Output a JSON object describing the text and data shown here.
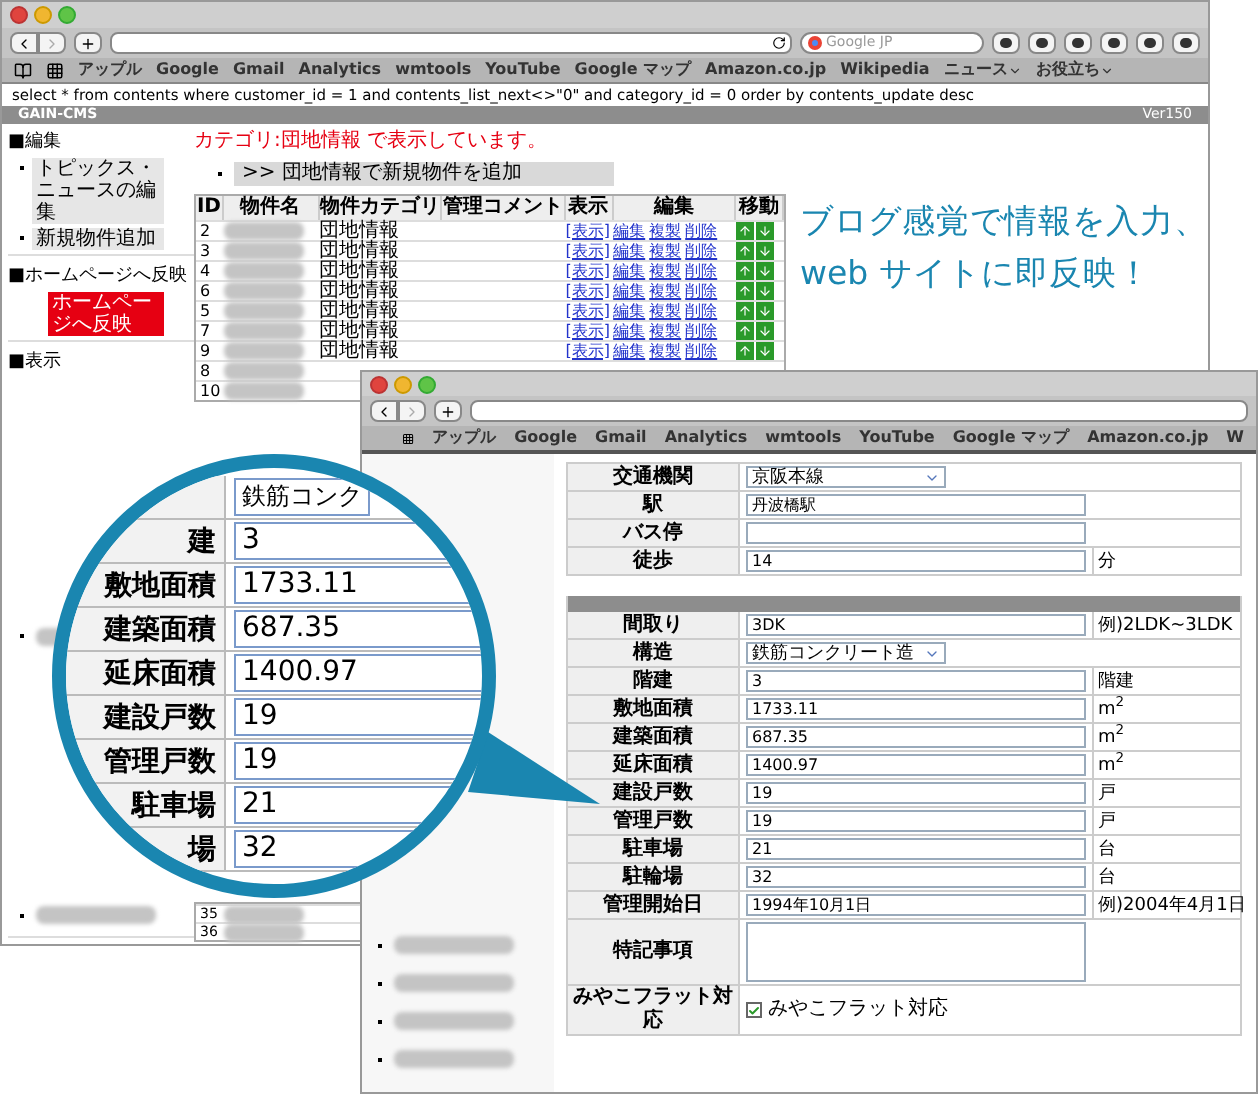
{
  "back_window": {
    "search_placeholder": "Google JP",
    "bookmarks": [
      {
        "label": "アップル",
        "menu": false
      },
      {
        "label": "Google",
        "menu": false
      },
      {
        "label": "Gmail",
        "menu": false
      },
      {
        "label": "Analytics",
        "menu": false
      },
      {
        "label": "wmtools",
        "menu": false
      },
      {
        "label": "YouTube",
        "menu": false
      },
      {
        "label": "Google マップ",
        "menu": false
      },
      {
        "label": "Amazon.co.jp",
        "menu": false
      },
      {
        "label": "Wikipedia",
        "menu": false
      },
      {
        "label": "ニュース",
        "menu": true
      },
      {
        "label": "お役立ち",
        "menu": true
      }
    ],
    "query": "select * from contents where customer_id = 1 and contents_list_next<>\"0\" and category_id = 0 order by contents_update desc",
    "app_title": "GAIN-CMS",
    "version": "Ver150",
    "sidebar": [
      {
        "title": "■編集",
        "items": [
          {
            "kind": "link",
            "label": "トピックス・ニュースの編集"
          },
          {
            "kind": "link",
            "label": "新規物件追加"
          }
        ]
      },
      {
        "title": "■ホームページへ反映",
        "items": [
          {
            "kind": "publish",
            "label": "ホームページへ反映"
          }
        ]
      },
      {
        "title": "■表示",
        "items": [
          {
            "kind": "blurred"
          },
          {
            "kind": "blurred"
          }
        ]
      }
    ],
    "notice": "カテゴリ:団地情報 で表示しています。",
    "add_button": ">> 団地情報で新規物件を追加",
    "table": {
      "columns": [
        "ID",
        "物件名",
        "物件カテゴリ",
        "管理コメント",
        "表示",
        "編集",
        "移動"
      ],
      "rows": [
        {
          "id": "2",
          "category": "団地情報",
          "view": "[表示]",
          "actions": [
            "編集",
            "複製",
            "削除"
          ]
        },
        {
          "id": "3",
          "category": "団地情報",
          "view": "[表示]",
          "actions": [
            "編集",
            "複製",
            "削除"
          ]
        },
        {
          "id": "4",
          "category": "団地情報",
          "view": "[表示]",
          "actions": [
            "編集",
            "複製",
            "削除"
          ]
        },
        {
          "id": "6",
          "category": "団地情報",
          "view": "[表示]",
          "actions": [
            "編集",
            "複製",
            "削除"
          ]
        },
        {
          "id": "5",
          "category": "団地情報",
          "view": "[表示]",
          "actions": [
            "編集",
            "複製",
            "削除"
          ]
        },
        {
          "id": "7",
          "category": "団地情報",
          "view": "[表示]",
          "actions": [
            "編集",
            "複製",
            "削除"
          ]
        },
        {
          "id": "9",
          "category": "団地情報",
          "view": "[表示]",
          "actions": [
            "編集",
            "複製",
            "削除"
          ]
        },
        {
          "id": "8"
        },
        {
          "id": "10"
        }
      ],
      "last_rows": [
        {
          "id": "35"
        },
        {
          "id": "36"
        }
      ]
    }
  },
  "headline": [
    "ブログ感覚で情報を入力、",
    "web サイトに即反映！"
  ],
  "front_window": {
    "bookmarks": [
      {
        "label": "アップル"
      },
      {
        "label": "Google"
      },
      {
        "label": "Gmail"
      },
      {
        "label": "Analytics"
      },
      {
        "label": "wmtools"
      },
      {
        "label": "YouTube"
      },
      {
        "label": "Google マップ"
      },
      {
        "label": "Amazon.co.jp"
      },
      {
        "label": "W"
      }
    ],
    "access": [
      {
        "label": "交通機関",
        "kind": "select",
        "value": "京阪本線"
      },
      {
        "label": "駅",
        "kind": "text",
        "value": "丹波橋駅"
      },
      {
        "label": "バス停",
        "kind": "text"
      },
      {
        "label": "徒歩",
        "kind": "text",
        "value": "14",
        "unit": "分"
      }
    ],
    "details": [
      {
        "label": "間取り",
        "kind": "text",
        "value": "3DK",
        "unit": "例)2LDK~3LDK"
      },
      {
        "label": "構造",
        "kind": "select",
        "value": "鉄筋コンクリート造"
      },
      {
        "label": "階建",
        "kind": "text",
        "value": "3",
        "unit": "階建"
      },
      {
        "label": "敷地面積",
        "kind": "text",
        "value": "1733.11",
        "unit": "m$^{2}$"
      },
      {
        "label": "建築面積",
        "kind": "text",
        "value": "687.35",
        "unit": "m$^{2}$"
      },
      {
        "label": "延床面積",
        "kind": "text",
        "value": "1400.97",
        "unit": "m$^{2}$"
      },
      {
        "label": "建設戸数",
        "kind": "text",
        "value": "19",
        "unit": "戸"
      },
      {
        "label": "管理戸数",
        "kind": "text",
        "value": "19",
        "unit": "戸"
      },
      {
        "label": "駐車場",
        "kind": "text",
        "value": "21",
        "unit": "台"
      },
      {
        "label": "駐輪場",
        "kind": "text",
        "value": "32",
        "unit": "台"
      },
      {
        "label": "管理開始日",
        "kind": "text",
        "value": "1994年10月1日",
        "unit": "例)2004年4月1日"
      },
      {
        "label": "特記事項",
        "kind": "textarea"
      },
      {
        "label": "みやこフラット対応",
        "kind": "checkbox",
        "checked": true,
        "text": "みやこフラット対応"
      }
    ]
  },
  "magnifier": {
    "rows": [
      {
        "value": "鉄筋コンク"
      },
      {
        "label": "建",
        "value": "3"
      },
      {
        "label": "敷地面積",
        "value": "1733.11"
      },
      {
        "label": "建築面積",
        "value": "687.35"
      },
      {
        "label": "延床面積",
        "value": "1400.97"
      },
      {
        "label": "建設戸数",
        "value": "19"
      },
      {
        "label": "管理戸数",
        "value": "19"
      },
      {
        "label": "駐車場",
        "value": "21"
      },
      {
        "label": "場",
        "value": "32"
      }
    ]
  }
}
